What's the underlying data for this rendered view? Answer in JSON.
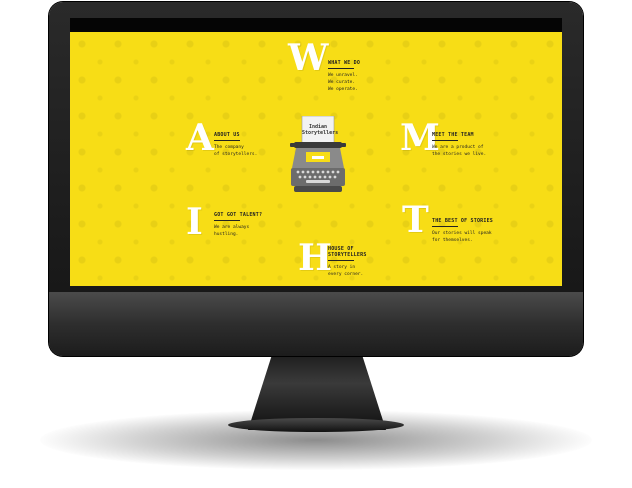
{
  "logo": {
    "line1": "Indian",
    "line2": "Storytellers"
  },
  "letters": {
    "w": "W",
    "a": "A",
    "i": "I",
    "h": "H",
    "m": "M",
    "t": "T"
  },
  "sections": [
    {
      "title": "WHAT WE DO",
      "body": [
        "We unravel.",
        "We curate.",
        "We operate."
      ]
    },
    {
      "title": "ABOUT US",
      "body": [
        "The company",
        "of storytellers."
      ]
    },
    {
      "title": "MEET THE TEAM",
      "body": [
        "We are a product of",
        "the stories we live."
      ]
    },
    {
      "title": "GOT GOT TALENT?",
      "body": [
        "We are always",
        "hustling."
      ]
    },
    {
      "title": "THE BEST OF STORIES",
      "body": [
        "Our stories will speak",
        "for themselves."
      ]
    },
    {
      "title": "HOUSE OF STORYTELLERS",
      "body": [
        "A story in",
        "every corner."
      ]
    }
  ],
  "colors": {
    "background": "#f7dd16",
    "letters": "#ffffff",
    "text": "#222222",
    "bezel": "#1a1a1a"
  }
}
